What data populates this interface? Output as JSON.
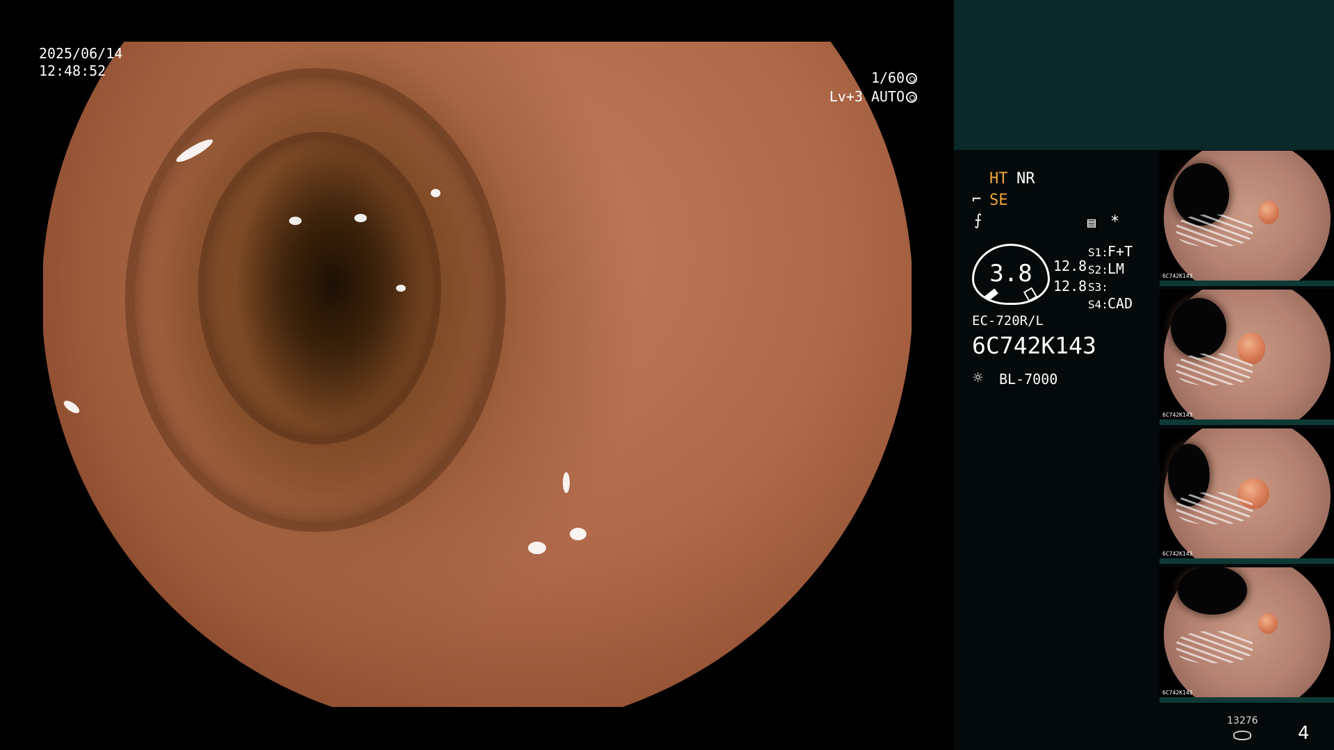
{
  "overlay": {
    "date": "2025/06/14",
    "time": "12:48:52",
    "shutter": "1/60",
    "level": "Lv+3",
    "mode": "AUTO"
  },
  "panel": {
    "ht": "HT",
    "nr": "NR",
    "se": "SE",
    "asterisk": "*",
    "gauge_value": "3.8",
    "side_values": [
      "12.8",
      "12.8"
    ],
    "settings": [
      {
        "key": "S1:",
        "value": "F+T"
      },
      {
        "key": "S2:",
        "value": "LM"
      },
      {
        "key": "S3:",
        "value": ""
      },
      {
        "key": "S4:",
        "value": "CAD"
      }
    ],
    "scope_model": "EC-720R/L",
    "serial": "6C742K143",
    "light_source": "BL-7000",
    "counter": "13276",
    "page": "4"
  },
  "thumbnails": [
    {
      "label": "6C742K143"
    },
    {
      "label": "6C742K143"
    },
    {
      "label": "6C742K143"
    },
    {
      "label": "6C742K143"
    }
  ],
  "colors": {
    "panel_bg": "#04090a",
    "panel_top": "#0a2a2a",
    "accent_orange": "#f2a53a",
    "thumb_bar": "#0e3a36"
  }
}
